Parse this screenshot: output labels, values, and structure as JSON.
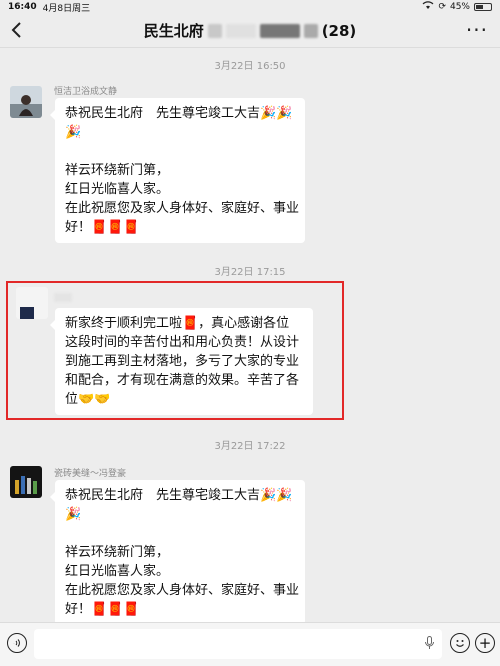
{
  "status": {
    "time": "16:40",
    "date": "4月8日周三",
    "battery": "45%"
  },
  "header": {
    "title": "民生北府",
    "count": "(28)",
    "more": "···"
  },
  "messages": [
    {
      "timestamp": "3月22日 16:50",
      "sender": "恒洁卫浴成文静",
      "lines": [
        "恭祝民生北府　先生尊宅竣工大吉🎉🎉",
        "🎉",
        "",
        "祥云环绕新门第，",
        "红日光临喜人家。",
        "在此祝愿您及家人身体好、家庭好、事业",
        "好！🧧🧧🧧"
      ]
    },
    {
      "timestamp": "3月22日 17:15",
      "sender": "",
      "lines": [
        "新家终于顺利完工啦🧧，真心感谢各位",
        "这段时间的辛苦付出和用心负责！从设计",
        "到施工再到主材落地，多亏了大家的专业",
        "和配合，才有现在满意的效果。辛苦了各",
        "位🤝🤝"
      ]
    },
    {
      "timestamp": "3月22日 17:22",
      "sender": "瓷砖美缝～冯登豪",
      "lines": [
        "恭祝民生北府　先生尊宅竣工大吉🎉🎉",
        "🎉",
        "",
        "祥云环绕新门第，",
        "红日光临喜人家。",
        "在此祝愿您及家人身体好、家庭好、事业",
        "好！🧧🧧🧧"
      ]
    }
  ],
  "icons": {
    "back": "chevron-left-icon",
    "voice": "voice-icon",
    "mic": "mic-icon",
    "emoji": "emoji-icon",
    "plus": "plus-icon"
  }
}
